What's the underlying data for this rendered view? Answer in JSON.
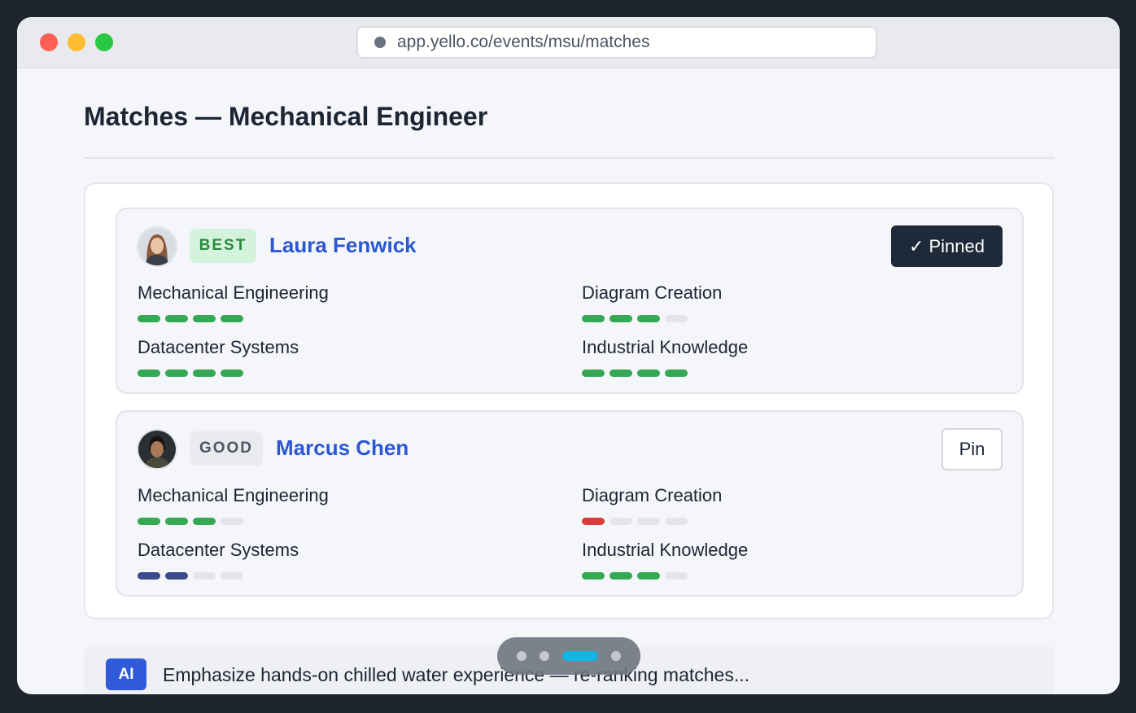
{
  "browser": {
    "url": "app.yello.co/events/msu/matches"
  },
  "page": {
    "title": "Matches — Mechanical Engineer"
  },
  "candidates": [
    {
      "badge": "BEST",
      "name": "Laura Fenwick",
      "action_label": "Pinned",
      "action_icon": "check-icon",
      "pinned": true,
      "skills": [
        {
          "label": "Mechanical Engineering",
          "level": 4,
          "max": 4,
          "color": "#34a853"
        },
        {
          "label": "Diagram Creation",
          "level": 3,
          "max": 4,
          "color": "#34a853"
        },
        {
          "label": "Datacenter Systems",
          "level": 4,
          "max": 4,
          "color": "#34a853"
        },
        {
          "label": "Industrial Knowledge",
          "level": 4,
          "max": 4,
          "color": "#34a853"
        }
      ]
    },
    {
      "badge": "GOOD",
      "name": "Marcus Chen",
      "action_label": "Pin",
      "pinned": false,
      "skills": [
        {
          "label": "Mechanical Engineering",
          "level": 3,
          "max": 4,
          "color": "#34a853"
        },
        {
          "label": "Diagram Creation",
          "level": 1,
          "max": 4,
          "color": "#dc3b3b"
        },
        {
          "label": "Datacenter Systems",
          "level": 2,
          "max": 4,
          "color": "#3b4a8c"
        },
        {
          "label": "Industrial Knowledge",
          "level": 3,
          "max": 4,
          "color": "#34a853"
        }
      ]
    }
  ],
  "ai_prompt": {
    "badge": "AI",
    "text": "Emphasize hands-on chilled water experience — re-ranking matches..."
  },
  "pagination": {
    "total": 4,
    "active_index": 2
  },
  "colors": {
    "accent": "#2b57d3",
    "pinned_button": "#1e2a39",
    "pager_active": "#12b4e0"
  }
}
